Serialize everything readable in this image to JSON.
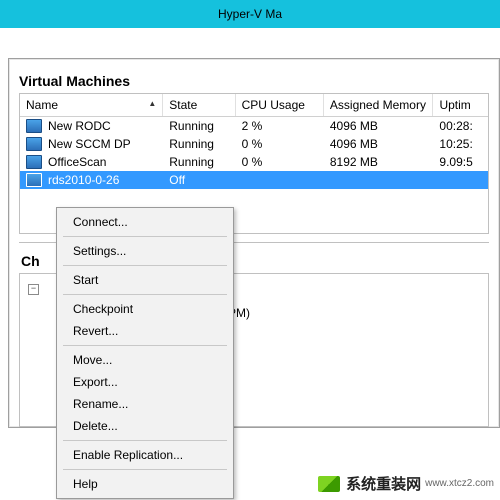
{
  "titlebar": {
    "title": "Hyper-V Ma"
  },
  "vm_section": {
    "title": "Virtual Machines",
    "columns": {
      "name": "Name",
      "state": "State",
      "cpu": "CPU Usage",
      "mem": "Assigned Memory",
      "uptime": "Uptim"
    },
    "rows": [
      {
        "name": "New RODC",
        "state": "Running",
        "cpu": "2 %",
        "mem": "4096 MB",
        "uptime": "00:28:"
      },
      {
        "name": "New SCCM DP",
        "state": "Running",
        "cpu": "0 %",
        "mem": "4096 MB",
        "uptime": "10:25:"
      },
      {
        "name": "OfficeScan",
        "state": "Running",
        "cpu": "0 %",
        "mem": "8192 MB",
        "uptime": "9.09:5"
      },
      {
        "name": "rds2010-0-26",
        "state": "Off",
        "cpu": "",
        "mem": "",
        "uptime": ""
      }
    ]
  },
  "checkpoints": {
    "title_short": "Ch",
    "text_fragment": "9 PM)"
  },
  "context_menu": {
    "connect": "Connect...",
    "settings": "Settings...",
    "start": "Start",
    "checkpoint": "Checkpoint",
    "revert": "Revert...",
    "move": "Move...",
    "export": "Export...",
    "rename": "Rename...",
    "delete": "Delete...",
    "enable_replication": "Enable Replication...",
    "help": "Help"
  },
  "watermark": {
    "main": "系统重装网",
    "sub": "www.xtcz2.com"
  }
}
